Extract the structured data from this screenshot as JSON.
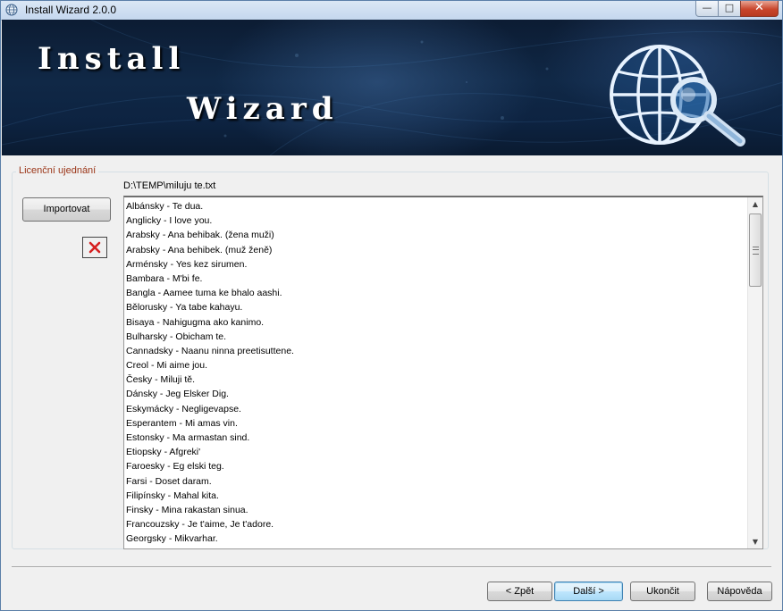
{
  "window": {
    "title": "Install Wizard 2.0.0",
    "controls": {
      "minimize": "—",
      "maximize": "□",
      "close": "✕"
    }
  },
  "banner": {
    "line1": "Install",
    "line2": "Wizard",
    "logo_icon": "globe-magnifier-icon"
  },
  "license": {
    "group_label": "Licenční ujednání",
    "file_path": "D:\\TEMP\\miluju te.txt",
    "import_label": "Importovat",
    "delete_icon": "red-x-icon",
    "lines": [
      "Albánsky - Te dua.",
      "Anglicky - I love you.",
      "Arabsky - Ana behibak. (žena muži)",
      "Arabsky - Ana behibek. (muž ženě)",
      "Arménsky - Yes kez sirumen.",
      "Bambara - M'bi fe.",
      "Bangla - Aamee tuma ke bhalo aashi.",
      "Bělorusky - Ya tabe kahayu.",
      "Bisaya - Nahigugma ako kanimo.",
      "Bulharsky - Obicham te.",
      "Cannadsky - Naanu ninna preetisuttene.",
      "Creol - Mi aime jou.",
      "Česky - Miluji tě.",
      "Dánsky - Jeg Elsker Dig.",
      "Eskymácky - Negligevapse.",
      "Esperantem - Mi amas vin.",
      "Estonsky - Ma armastan sind.",
      "Etiopsky - Afgreki'",
      "Faroesky - Eg elski teg.",
      "Farsi - Doset daram.",
      "Filipínsky - Mahal kita.",
      "Finsky - Mina rakastan sinua.",
      "Francouzsky - Je t'aime, Je t'adore.",
      "Georgsky - Mikvarhar."
    ]
  },
  "buttons": {
    "back": "< Zpět",
    "next": "Další >",
    "exit": "Ukončit",
    "help": "Nápověda"
  },
  "colors": {
    "banner_dark": "#0c1c33",
    "group_label": "#9a3416",
    "delete_x": "#d62020"
  }
}
